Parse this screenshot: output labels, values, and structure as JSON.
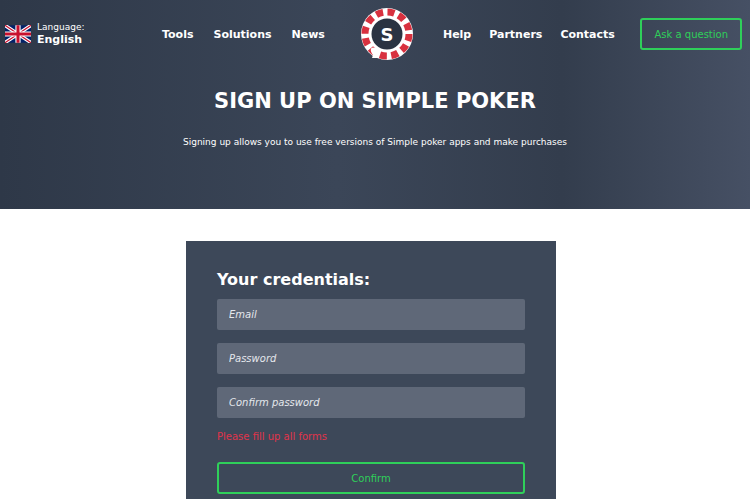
{
  "language": {
    "label": "Language:",
    "value": "English"
  },
  "nav": {
    "left": [
      "Tools",
      "Solutions",
      "News"
    ],
    "right": [
      "Help",
      "Partners",
      "Contacts"
    ]
  },
  "logo": {
    "letter": "S"
  },
  "ask_button": "Ask a question",
  "hero": {
    "title": "SIGN UP ON SIMPLE POKER",
    "subtitle": "Signing up allows you to use free versions of Simple poker apps and make purchases"
  },
  "form": {
    "heading": "Your credentials:",
    "fields": [
      {
        "placeholder": "Email",
        "kind": "email"
      },
      {
        "placeholder": "Password",
        "kind": "password"
      },
      {
        "placeholder": "Confirm password",
        "kind": "password"
      }
    ],
    "error": "Please fill up all forms",
    "submit": "Confirm"
  }
}
